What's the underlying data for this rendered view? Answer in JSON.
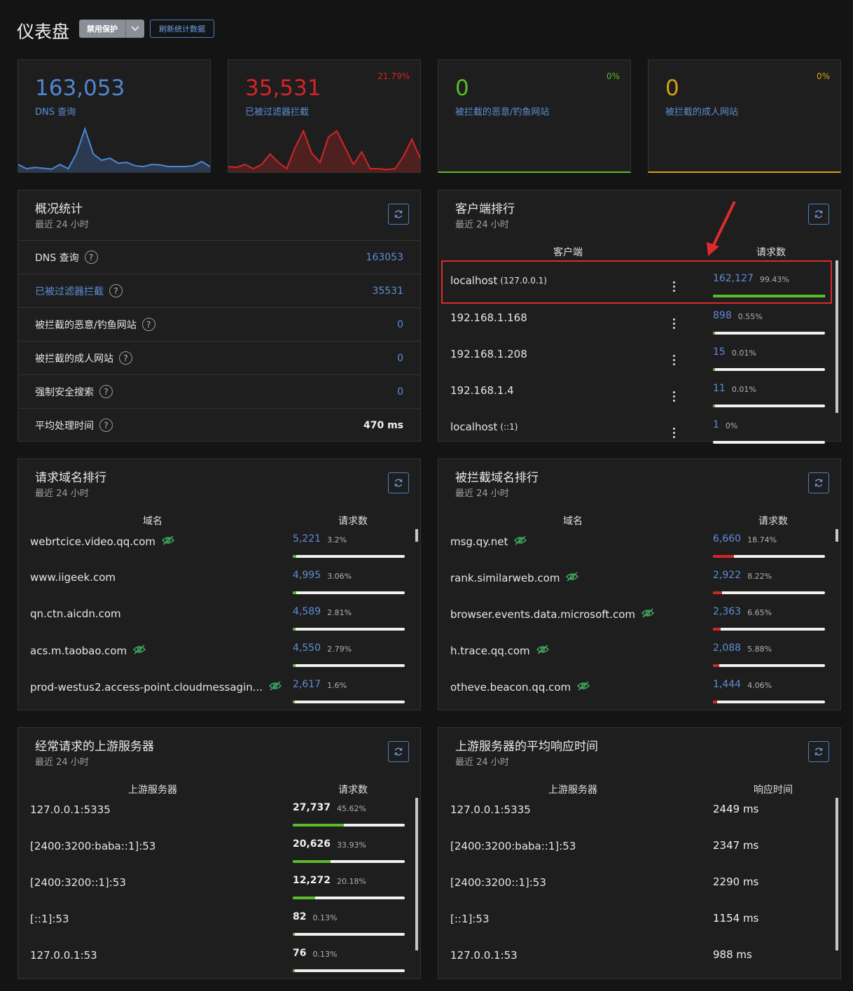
{
  "header": {
    "title": "仪表盘",
    "protect_label": "禁用保护",
    "refresh_label": "刷新统计数据"
  },
  "stats": [
    {
      "value": "163,053",
      "label": "DNS 查询",
      "pct": "",
      "color": "#4f86d4",
      "spark": [
        0.15,
        0.05,
        0.08,
        0.06,
        0.04,
        0.15,
        0.05,
        0.42,
        1.0,
        0.4,
        0.25,
        0.3,
        0.18,
        0.2,
        0.12,
        0.1,
        0.15,
        0.14,
        0.1,
        0.1,
        0.1,
        0.12,
        0.22,
        0.1
      ]
    },
    {
      "value": "35,531",
      "label": "已被过滤器拦截",
      "pct": "21.79%",
      "color": "#d02626",
      "spark": [
        0.1,
        0.08,
        0.15,
        0.05,
        0.15,
        0.4,
        0.2,
        0.05,
        0.55,
        0.95,
        0.42,
        0.2,
        0.8,
        0.95,
        0.55,
        0.15,
        0.45,
        0.05,
        0.05,
        0.03,
        0.05,
        0.35,
        0.75,
        0.3
      ]
    },
    {
      "value": "0",
      "label": "被拦截的恶意/钓鱼网站",
      "pct": "0%",
      "color": "#5aba27"
    },
    {
      "value": "0",
      "label": "被拦截的成人网站",
      "pct": "0%",
      "color": "#d8a012"
    }
  ],
  "overview": {
    "title": "概况统计",
    "subtitle": "最近 24 小时",
    "rows": [
      {
        "label": "DNS 查询",
        "value": "163053"
      },
      {
        "label": "已被过滤器拦截",
        "value": "35531"
      },
      {
        "label": "被拦截的恶意/钓鱼网站",
        "value": "0"
      },
      {
        "label": "被拦截的成人网站",
        "value": "0"
      },
      {
        "label": "强制安全搜索",
        "value": "0"
      },
      {
        "label": "平均处理时间",
        "value": "470 ms"
      }
    ]
  },
  "clients": {
    "title": "客户端排行",
    "subtitle": "最近 24 小时",
    "col1": "客户端",
    "col2": "请求数",
    "rows": [
      {
        "name": "localhost",
        "ip": "(127.0.0.1)",
        "count": "162,127",
        "pct": "99.43%",
        "fraction": 0.9943
      },
      {
        "name": "192.168.1.168",
        "ip": "",
        "count": "898",
        "pct": "0.55%",
        "fraction": 0.0055
      },
      {
        "name": "192.168.1.208",
        "ip": "",
        "count": "15",
        "pct": "0.01%",
        "fraction": 0.0001
      },
      {
        "name": "192.168.1.4",
        "ip": "",
        "count": "11",
        "pct": "0.01%",
        "fraction": 0.0001
      },
      {
        "name": "localhost",
        "ip": "(::1)",
        "count": "1",
        "pct": "0%",
        "fraction": 0
      }
    ]
  },
  "queried": {
    "title": "请求域名排行",
    "subtitle": "最近 24 小时",
    "col1": "域名",
    "col2": "请求数",
    "rows": [
      {
        "name": "webrtcice.video.qq.com",
        "count": "5,221",
        "pct": "3.2%",
        "eye": true,
        "fraction": 0.032
      },
      {
        "name": "www.iigeek.com",
        "count": "4,995",
        "pct": "3.06%",
        "eye": false,
        "fraction": 0.0306
      },
      {
        "name": "qn.ctn.aicdn.com",
        "count": "4,589",
        "pct": "2.81%",
        "eye": false,
        "fraction": 0.0281
      },
      {
        "name": "acs.m.taobao.com",
        "count": "4,550",
        "pct": "2.79%",
        "eye": true,
        "fraction": 0.0279
      },
      {
        "name": "prod-westus2.access-point.cloudmessagin...",
        "count": "2,617",
        "pct": "1.6%",
        "eye": true,
        "fraction": 0.016
      }
    ]
  },
  "blocked": {
    "title": "被拦截域名排行",
    "subtitle": "最近 24 小时",
    "col1": "域名",
    "col2": "请求数",
    "rows": [
      {
        "name": "msg.qy.net",
        "count": "6,660",
        "pct": "18.74%",
        "eye": true,
        "fraction": 0.1874
      },
      {
        "name": "rank.similarweb.com",
        "count": "2,922",
        "pct": "8.22%",
        "eye": true,
        "fraction": 0.0822
      },
      {
        "name": "browser.events.data.microsoft.com",
        "count": "2,363",
        "pct": "6.65%",
        "eye": true,
        "fraction": 0.0665
      },
      {
        "name": "h.trace.qq.com",
        "count": "2,088",
        "pct": "5.88%",
        "eye": true,
        "fraction": 0.0588
      },
      {
        "name": "otheve.beacon.qq.com",
        "count": "1,444",
        "pct": "4.06%",
        "eye": true,
        "fraction": 0.0406
      }
    ]
  },
  "upstreams": {
    "title": "经常请求的上游服务器",
    "subtitle": "最近 24 小时",
    "col1": "上游服务器",
    "col2": "请求数",
    "rows": [
      {
        "name": "127.0.0.1:5335",
        "count": "27,737",
        "pct": "45.62%",
        "fraction": 0.4562
      },
      {
        "name": "[2400:3200:baba::1]:53",
        "count": "20,626",
        "pct": "33.93%",
        "fraction": 0.3393
      },
      {
        "name": "[2400:3200::1]:53",
        "count": "12,272",
        "pct": "20.18%",
        "fraction": 0.2018
      },
      {
        "name": "[::1]:53",
        "count": "82",
        "pct": "0.13%",
        "fraction": 0.0013
      },
      {
        "name": "127.0.0.1:53",
        "count": "76",
        "pct": "0.13%",
        "fraction": 0.0013
      }
    ]
  },
  "avg_time": {
    "title": "上游服务器的平均响应时间",
    "subtitle": "最近 24 小时",
    "col1": "上游服务器",
    "col2": "响应时间",
    "rows": [
      {
        "name": "127.0.0.1:5335",
        "time": "2449 ms"
      },
      {
        "name": "[2400:3200:baba::1]:53",
        "time": "2347 ms"
      },
      {
        "name": "[2400:3200::1]:53",
        "time": "2290 ms"
      },
      {
        "name": "[::1]:53",
        "time": "1154 ms"
      },
      {
        "name": "127.0.0.1:53",
        "time": "988 ms"
      }
    ]
  },
  "colors": {
    "blue": "#5d8ed6",
    "red": "#d02626",
    "green": "#5aba27",
    "yellow": "#d8a012",
    "highlight": "#d92b2b"
  }
}
